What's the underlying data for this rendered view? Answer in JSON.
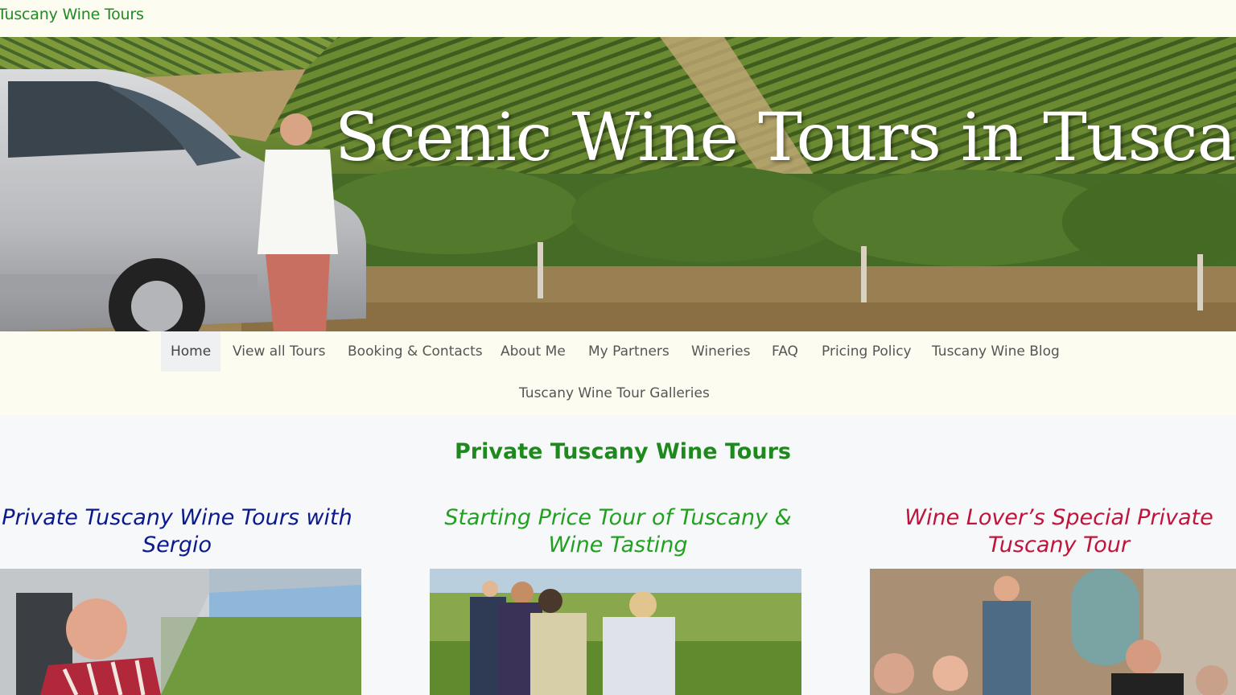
{
  "site": {
    "title": "Tuscany Wine Tours"
  },
  "hero": {
    "title": "Scenic Wine Tours in Tuscany"
  },
  "nav": {
    "items": [
      {
        "label": "Home",
        "active": true
      },
      {
        "label": "View all Tours"
      },
      {
        "label": "Booking & Contacts"
      },
      {
        "label": "About Me"
      },
      {
        "label": "My Partners"
      },
      {
        "label": "Wineries"
      },
      {
        "label": "FAQ"
      },
      {
        "label": "Pricing Policy"
      },
      {
        "label": "Tuscany Wine Blog"
      },
      {
        "label": "Tuscany Wine Tour Galleries"
      }
    ]
  },
  "main": {
    "section_title": "Private Tuscany Wine Tours",
    "cards": [
      {
        "title": "Private Tuscany Wine Tours with Sergio",
        "color": "#0a1a8c"
      },
      {
        "title": "Starting Price Tour of Tuscany & Wine Tasting",
        "color": "#22a022"
      },
      {
        "title": "Wine Lover’s Special Private Tuscany Tour",
        "color": "#c0143c"
      }
    ]
  },
  "colors": {
    "brand_green": "#1f8a22",
    "nav_background": "#fcfcf1",
    "page_background": "#f7f8f9"
  }
}
